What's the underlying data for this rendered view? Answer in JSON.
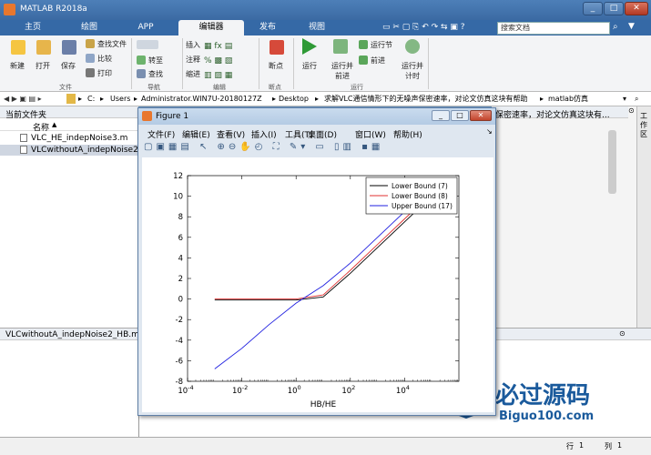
{
  "app": {
    "title": "MATLAB R2018a"
  },
  "tabs": [
    "主页",
    "绘图",
    "APP",
    "编辑器",
    "发布",
    "视图"
  ],
  "active_tab": 3,
  "search": {
    "placeholder": "搜索文档"
  },
  "ribbon": {
    "buttons": [
      "新建",
      "打开",
      "保存",
      "查找文件",
      "比较",
      "打印",
      "转至",
      "查找",
      "插入",
      "注释",
      "缩进",
      "断点",
      "运行",
      "运行并前进",
      "运行节",
      "前进",
      "运行并计时"
    ],
    "groups": [
      "文件",
      "导航",
      "编辑",
      "断点",
      "运行"
    ]
  },
  "address": {
    "path": [
      "C:",
      "Users",
      "Administrator.WIN7U-20180127Z",
      "Desktop",
      "求解VLC通信情形下的无噪声保密速率，对论文仿真这块有帮助",
      "matlab仿真"
    ]
  },
  "left_panel": {
    "header": "当前文件夹",
    "column": "名称",
    "files": [
      "VLC_HE_indepNoise3.m",
      "VLCwithoutA_indepNoise2_HB.m"
    ],
    "details_title": "VLCwithoutA_indepNoise2_HB.m"
  },
  "right_panel": {
    "path_fragment": "保密速率，对论文仿真这块有...",
    "side_label": "工作区"
  },
  "status": {
    "row_label": "行",
    "row_value": "1",
    "col_label": "列",
    "col_value": "1"
  },
  "figure": {
    "title": "Figure 1",
    "menu": [
      "文件(F)",
      "编辑(E)",
      "查看(V)",
      "插入(I)",
      "工具(T)",
      "桌面(D)",
      "窗口(W)",
      "帮助(H)"
    ]
  },
  "watermark": {
    "brand": "必过源码",
    "domain": "Biguo100.com"
  },
  "chart_data": {
    "type": "line",
    "xlabel": "HB/HE",
    "ylabel": "",
    "xscale": "log",
    "xlim": [
      0.0001,
      1000000
    ],
    "ylim": [
      -8,
      12
    ],
    "xticks": [
      0.0001,
      0.01,
      1,
      100,
      10000
    ],
    "xtick_labels": [
      [
        "10",
        "-4"
      ],
      [
        "10",
        "-2"
      ],
      [
        "10",
        "0"
      ],
      [
        "10",
        "2"
      ],
      [
        "10",
        "4"
      ]
    ],
    "yticks": [
      -8,
      -6,
      -4,
      -2,
      0,
      2,
      4,
      6,
      8,
      10,
      12
    ],
    "legend_position": "top-right",
    "series": [
      {
        "name": "Lower Bound (7)",
        "color": "#000000",
        "x": [
          0.001,
          0.01,
          0.1,
          1,
          10,
          100,
          1000,
          10000,
          100000
        ],
        "y": [
          -0.1,
          -0.1,
          -0.1,
          -0.1,
          0.2,
          2.5,
          5.0,
          7.5,
          10.0
        ]
      },
      {
        "name": "Lower Bound (8)",
        "color": "#e03030",
        "x": [
          0.001,
          0.01,
          0.1,
          1,
          10,
          100,
          1000,
          10000,
          100000
        ],
        "y": [
          0.0,
          0.0,
          0.0,
          0.0,
          0.4,
          2.8,
          5.3,
          7.8,
          10.3
        ]
      },
      {
        "name": "Upper Bound (17)",
        "color": "#2020e0",
        "x": [
          0.001,
          0.01,
          0.1,
          1,
          10,
          100,
          1000,
          10000,
          100000
        ],
        "y": [
          -6.8,
          -4.8,
          -2.5,
          -0.4,
          1.3,
          3.5,
          6.0,
          8.5,
          11.0
        ]
      }
    ]
  }
}
